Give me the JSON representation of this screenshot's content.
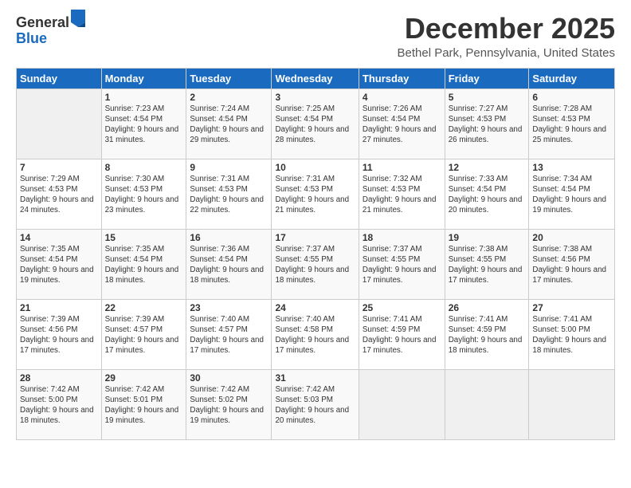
{
  "logo": {
    "general": "General",
    "blue": "Blue"
  },
  "title": "December 2025",
  "location": "Bethel Park, Pennsylvania, United States",
  "days_of_week": [
    "Sunday",
    "Monday",
    "Tuesday",
    "Wednesday",
    "Thursday",
    "Friday",
    "Saturday"
  ],
  "weeks": [
    [
      {
        "day": "",
        "sunrise": "",
        "sunset": "",
        "daylight": ""
      },
      {
        "day": "1",
        "sunrise": "Sunrise: 7:23 AM",
        "sunset": "Sunset: 4:54 PM",
        "daylight": "Daylight: 9 hours and 31 minutes."
      },
      {
        "day": "2",
        "sunrise": "Sunrise: 7:24 AM",
        "sunset": "Sunset: 4:54 PM",
        "daylight": "Daylight: 9 hours and 29 minutes."
      },
      {
        "day": "3",
        "sunrise": "Sunrise: 7:25 AM",
        "sunset": "Sunset: 4:54 PM",
        "daylight": "Daylight: 9 hours and 28 minutes."
      },
      {
        "day": "4",
        "sunrise": "Sunrise: 7:26 AM",
        "sunset": "Sunset: 4:54 PM",
        "daylight": "Daylight: 9 hours and 27 minutes."
      },
      {
        "day": "5",
        "sunrise": "Sunrise: 7:27 AM",
        "sunset": "Sunset: 4:53 PM",
        "daylight": "Daylight: 9 hours and 26 minutes."
      },
      {
        "day": "6",
        "sunrise": "Sunrise: 7:28 AM",
        "sunset": "Sunset: 4:53 PM",
        "daylight": "Daylight: 9 hours and 25 minutes."
      }
    ],
    [
      {
        "day": "7",
        "sunrise": "Sunrise: 7:29 AM",
        "sunset": "Sunset: 4:53 PM",
        "daylight": "Daylight: 9 hours and 24 minutes."
      },
      {
        "day": "8",
        "sunrise": "Sunrise: 7:30 AM",
        "sunset": "Sunset: 4:53 PM",
        "daylight": "Daylight: 9 hours and 23 minutes."
      },
      {
        "day": "9",
        "sunrise": "Sunrise: 7:31 AM",
        "sunset": "Sunset: 4:53 PM",
        "daylight": "Daylight: 9 hours and 22 minutes."
      },
      {
        "day": "10",
        "sunrise": "Sunrise: 7:31 AM",
        "sunset": "Sunset: 4:53 PM",
        "daylight": "Daylight: 9 hours and 21 minutes."
      },
      {
        "day": "11",
        "sunrise": "Sunrise: 7:32 AM",
        "sunset": "Sunset: 4:53 PM",
        "daylight": "Daylight: 9 hours and 21 minutes."
      },
      {
        "day": "12",
        "sunrise": "Sunrise: 7:33 AM",
        "sunset": "Sunset: 4:54 PM",
        "daylight": "Daylight: 9 hours and 20 minutes."
      },
      {
        "day": "13",
        "sunrise": "Sunrise: 7:34 AM",
        "sunset": "Sunset: 4:54 PM",
        "daylight": "Daylight: 9 hours and 19 minutes."
      }
    ],
    [
      {
        "day": "14",
        "sunrise": "Sunrise: 7:35 AM",
        "sunset": "Sunset: 4:54 PM",
        "daylight": "Daylight: 9 hours and 19 minutes."
      },
      {
        "day": "15",
        "sunrise": "Sunrise: 7:35 AM",
        "sunset": "Sunset: 4:54 PM",
        "daylight": "Daylight: 9 hours and 18 minutes."
      },
      {
        "day": "16",
        "sunrise": "Sunrise: 7:36 AM",
        "sunset": "Sunset: 4:54 PM",
        "daylight": "Daylight: 9 hours and 18 minutes."
      },
      {
        "day": "17",
        "sunrise": "Sunrise: 7:37 AM",
        "sunset": "Sunset: 4:55 PM",
        "daylight": "Daylight: 9 hours and 18 minutes."
      },
      {
        "day": "18",
        "sunrise": "Sunrise: 7:37 AM",
        "sunset": "Sunset: 4:55 PM",
        "daylight": "Daylight: 9 hours and 17 minutes."
      },
      {
        "day": "19",
        "sunrise": "Sunrise: 7:38 AM",
        "sunset": "Sunset: 4:55 PM",
        "daylight": "Daylight: 9 hours and 17 minutes."
      },
      {
        "day": "20",
        "sunrise": "Sunrise: 7:38 AM",
        "sunset": "Sunset: 4:56 PM",
        "daylight": "Daylight: 9 hours and 17 minutes."
      }
    ],
    [
      {
        "day": "21",
        "sunrise": "Sunrise: 7:39 AM",
        "sunset": "Sunset: 4:56 PM",
        "daylight": "Daylight: 9 hours and 17 minutes."
      },
      {
        "day": "22",
        "sunrise": "Sunrise: 7:39 AM",
        "sunset": "Sunset: 4:57 PM",
        "daylight": "Daylight: 9 hours and 17 minutes."
      },
      {
        "day": "23",
        "sunrise": "Sunrise: 7:40 AM",
        "sunset": "Sunset: 4:57 PM",
        "daylight": "Daylight: 9 hours and 17 minutes."
      },
      {
        "day": "24",
        "sunrise": "Sunrise: 7:40 AM",
        "sunset": "Sunset: 4:58 PM",
        "daylight": "Daylight: 9 hours and 17 minutes."
      },
      {
        "day": "25",
        "sunrise": "Sunrise: 7:41 AM",
        "sunset": "Sunset: 4:59 PM",
        "daylight": "Daylight: 9 hours and 17 minutes."
      },
      {
        "day": "26",
        "sunrise": "Sunrise: 7:41 AM",
        "sunset": "Sunset: 4:59 PM",
        "daylight": "Daylight: 9 hours and 18 minutes."
      },
      {
        "day": "27",
        "sunrise": "Sunrise: 7:41 AM",
        "sunset": "Sunset: 5:00 PM",
        "daylight": "Daylight: 9 hours and 18 minutes."
      }
    ],
    [
      {
        "day": "28",
        "sunrise": "Sunrise: 7:42 AM",
        "sunset": "Sunset: 5:00 PM",
        "daylight": "Daylight: 9 hours and 18 minutes."
      },
      {
        "day": "29",
        "sunrise": "Sunrise: 7:42 AM",
        "sunset": "Sunset: 5:01 PM",
        "daylight": "Daylight: 9 hours and 19 minutes."
      },
      {
        "day": "30",
        "sunrise": "Sunrise: 7:42 AM",
        "sunset": "Sunset: 5:02 PM",
        "daylight": "Daylight: 9 hours and 19 minutes."
      },
      {
        "day": "31",
        "sunrise": "Sunrise: 7:42 AM",
        "sunset": "Sunset: 5:03 PM",
        "daylight": "Daylight: 9 hours and 20 minutes."
      },
      {
        "day": "",
        "sunrise": "",
        "sunset": "",
        "daylight": ""
      },
      {
        "day": "",
        "sunrise": "",
        "sunset": "",
        "daylight": ""
      },
      {
        "day": "",
        "sunrise": "",
        "sunset": "",
        "daylight": ""
      }
    ]
  ]
}
